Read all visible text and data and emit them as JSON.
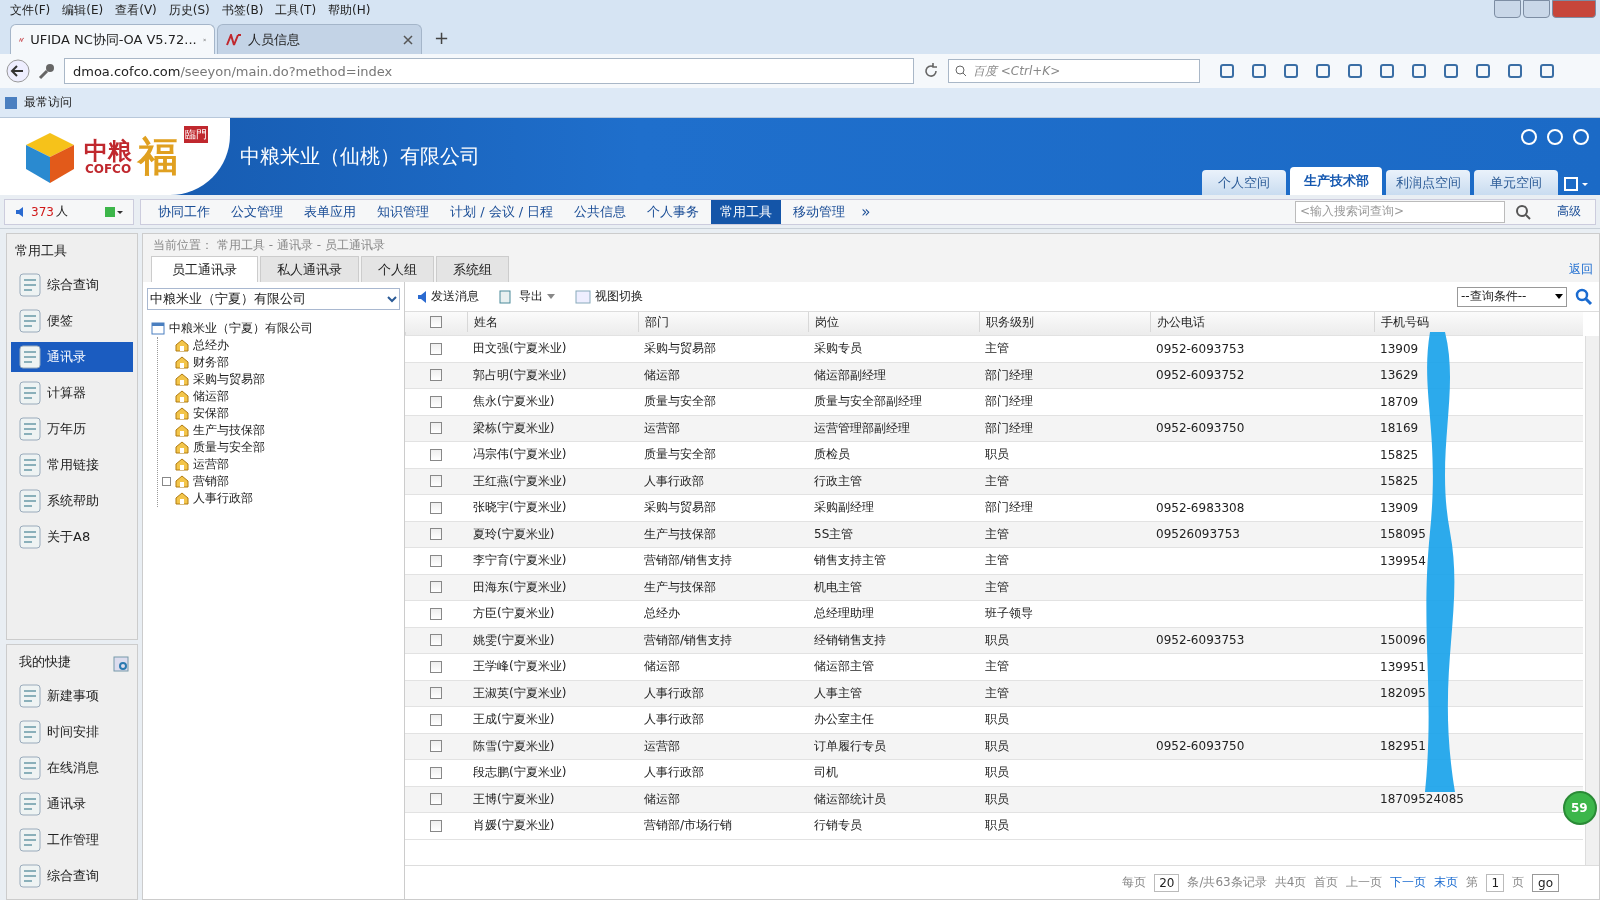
{
  "browser": {
    "menu": [
      "文件(F)",
      "编辑(E)",
      "查看(V)",
      "历史(S)",
      "书签(B)",
      "工具(T)",
      "帮助(H)"
    ],
    "tabs": [
      {
        "label": "UFIDA NC协同-OA V5.72...",
        "selected": true
      },
      {
        "label": "人员信息",
        "selected": false
      }
    ],
    "new_tab": "+",
    "url_host": "dmoa.cofco.com",
    "url_path": "/seeyon/main.do?method=index",
    "search_placeholder": "百度 <Ctrl+K>",
    "bookmark": "最常访问"
  },
  "header": {
    "logo_cn": "中粮",
    "logo_en": "COFCO",
    "logo_mark": "福",
    "logo_sub": "臨門",
    "company": "中粮米业（仙桃）有限公司",
    "space_tabs": [
      {
        "label": "个人空间",
        "selected": false
      },
      {
        "label": "生产技术部",
        "selected": true
      },
      {
        "label": "利润点空间",
        "selected": false
      },
      {
        "label": "单元空间",
        "selected": false
      }
    ]
  },
  "navbar": {
    "online_count": "373",
    "online_unit": "人",
    "items": [
      {
        "label": "协同工作",
        "selected": false
      },
      {
        "label": "公文管理",
        "selected": false
      },
      {
        "label": "表单应用",
        "selected": false
      },
      {
        "label": "知识管理",
        "selected": false
      },
      {
        "label": "计划 / 会议 / 日程",
        "selected": false
      },
      {
        "label": "公共信息",
        "selected": false
      },
      {
        "label": "个人事务",
        "selected": false
      },
      {
        "label": "常用工具",
        "selected": true
      },
      {
        "label": "移动管理",
        "selected": false
      }
    ],
    "more": "»",
    "search_placeholder": "<输入搜索词查询>",
    "advanced": "高级"
  },
  "sidebar": {
    "title": "常用工具",
    "items": [
      {
        "label": "综合查询",
        "selected": false
      },
      {
        "label": "便签",
        "selected": false
      },
      {
        "label": "通讯录",
        "selected": true
      },
      {
        "label": "计算器",
        "selected": false
      },
      {
        "label": "万年历",
        "selected": false
      },
      {
        "label": "常用链接",
        "selected": false
      },
      {
        "label": "系统帮助",
        "selected": false
      },
      {
        "label": "关于A8",
        "selected": false
      }
    ],
    "shortcuts_title": "我的快捷",
    "shortcuts": [
      "新建事项",
      "时间安排",
      "在线消息",
      "通讯录",
      "工作管理",
      "综合查询"
    ]
  },
  "breadcrumb": {
    "label": "当前位置：",
    "path": "常用工具 - 通讯录 - 员工通讯录"
  },
  "tabs": [
    {
      "label": "员工通讯录",
      "selected": true
    },
    {
      "label": "私人通讯录",
      "selected": false
    },
    {
      "label": "个人组",
      "selected": false
    },
    {
      "label": "系统组",
      "selected": false
    }
  ],
  "back": "返回",
  "org_select": "中粮米业（宁夏）有限公司",
  "tree": {
    "label": "中粮米业（宁夏）有限公司",
    "children": [
      {
        "label": "总经办",
        "collapsed": false
      },
      {
        "label": "财务部",
        "collapsed": false
      },
      {
        "label": "采购与贸易部",
        "collapsed": false
      },
      {
        "label": "储运部",
        "collapsed": false
      },
      {
        "label": "安保部",
        "collapsed": false
      },
      {
        "label": "生产与技保部",
        "collapsed": false
      },
      {
        "label": "质量与安全部",
        "collapsed": false
      },
      {
        "label": "运营部",
        "collapsed": false
      },
      {
        "label": "营销部",
        "collapsed": true
      },
      {
        "label": "人事行政部",
        "collapsed": false
      }
    ]
  },
  "toolbar": {
    "send": "发送消息",
    "export": "导出",
    "view": "视图切换",
    "query": "--查询条件--"
  },
  "table": {
    "header_checked": false,
    "columns": [
      "姓名",
      "部门",
      "岗位",
      "职务级别",
      "办公电话",
      "手机号码"
    ],
    "rows": [
      {
        "checked": false,
        "cells": [
          "田文强(宁夏米业)",
          "采购与贸易部",
          "采购专员",
          "主管",
          "0952-6093753",
          "13909"
        ]
      },
      {
        "checked": false,
        "cells": [
          "郭占明(宁夏米业)",
          "储运部",
          "储运部副经理",
          "部门经理",
          "0952-6093752",
          "13629"
        ]
      },
      {
        "checked": false,
        "cells": [
          "焦永(宁夏米业)",
          "质量与安全部",
          "质量与安全部副经理",
          "部门经理",
          "",
          "18709"
        ]
      },
      {
        "checked": false,
        "cells": [
          "梁栋(宁夏米业)",
          "运营部",
          "运营管理部副经理",
          "部门经理",
          "0952-6093750",
          "18169"
        ]
      },
      {
        "checked": false,
        "cells": [
          "冯宗伟(宁夏米业)",
          "质量与安全部",
          "质检员",
          "职员",
          "",
          "15825"
        ]
      },
      {
        "checked": false,
        "cells": [
          "王红燕(宁夏米业)",
          "人事行政部",
          "行政主管",
          "主管",
          "",
          "15825"
        ]
      },
      {
        "checked": false,
        "cells": [
          "张晓宇(宁夏米业)",
          "采购与贸易部",
          "采购副经理",
          "部门经理",
          "0952-6983308",
          "13909"
        ]
      },
      {
        "checked": false,
        "cells": [
          "夏玲(宁夏米业)",
          "生产与技保部",
          "5S主管",
          "主管",
          "09526093753",
          "158095"
        ]
      },
      {
        "checked": false,
        "cells": [
          "李宁育(宁夏米业)",
          "营销部/销售支持",
          "销售支持主管",
          "主管",
          "",
          "139954"
        ]
      },
      {
        "checked": false,
        "cells": [
          "田海东(宁夏米业)",
          "生产与技保部",
          "机电主管",
          "主管",
          "",
          ""
        ]
      },
      {
        "checked": false,
        "cells": [
          "方臣(宁夏米业)",
          "总经办",
          "总经理助理",
          "班子领导",
          "",
          ""
        ]
      },
      {
        "checked": false,
        "cells": [
          "姚雯(宁夏米业)",
          "营销部/销售支持",
          "经销销售支持",
          "职员",
          "0952-6093753",
          "150096"
        ]
      },
      {
        "checked": false,
        "cells": [
          "王学峰(宁夏米业)",
          "储运部",
          "储运部主管",
          "主管",
          "",
          "139951"
        ]
      },
      {
        "checked": false,
        "cells": [
          "王淑英(宁夏米业)",
          "人事行政部",
          "人事主管",
          "主管",
          "",
          "182095"
        ]
      },
      {
        "checked": false,
        "cells": [
          "王成(宁夏米业)",
          "人事行政部",
          "办公室主任",
          "职员",
          "",
          ""
        ]
      },
      {
        "checked": false,
        "cells": [
          "陈雪(宁夏米业)",
          "运营部",
          "订单履行专员",
          "职员",
          "0952-6093750",
          "182951"
        ]
      },
      {
        "checked": false,
        "cells": [
          "段志鹏(宁夏米业)",
          "人事行政部",
          "司机",
          "职员",
          "",
          ""
        ]
      },
      {
        "checked": false,
        "cells": [
          "王博(宁夏米业)",
          "储运部",
          "储运部统计员",
          "职员",
          "",
          "18709524085"
        ]
      },
      {
        "checked": false,
        "cells": [
          "肖媛(宁夏米业)",
          "营销部/市场行销",
          "行销专员",
          "职员",
          "",
          ""
        ]
      }
    ]
  },
  "pager": {
    "per_page": "每页",
    "page_size": "20",
    "records": "条/共63条记录",
    "pages": "共4页",
    "first": "首页",
    "prev": "上一页",
    "next": "下一页",
    "last": "末页",
    "page_label": "第",
    "page": "1",
    "page_unit": "页",
    "go": "go"
  },
  "badge": "59"
}
